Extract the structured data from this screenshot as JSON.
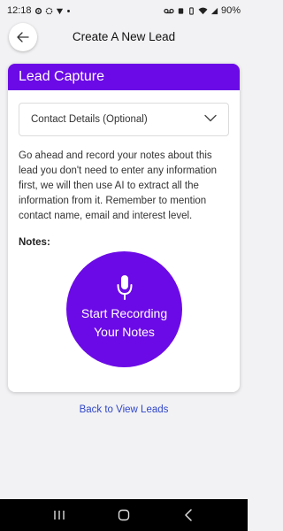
{
  "status_bar": {
    "time": "12:18",
    "battery": "90%",
    "left_icons": [
      "gear-icon",
      "settings-icon",
      "location-icon",
      "dot-icon"
    ],
    "right_icons": [
      "voicemail-icon",
      "alarm-icon",
      "vibrate-icon",
      "wifi-icon",
      "signal-icon"
    ]
  },
  "header": {
    "title": "Create A New Lead",
    "back_icon": "arrow-left-icon"
  },
  "card": {
    "title": "Lead Capture",
    "dropdown": {
      "label": "Contact Details (Optional)",
      "icon": "chevron-down-icon"
    },
    "instructions": "Go ahead and record your notes about this lead you don't need to enter any information first, we will then use AI to extract all the information from it. Remember to mention contact name, email and interest level.",
    "notes_label": "Notes:",
    "record_button": {
      "line1": "Start Recording",
      "line2": "Your Notes",
      "icon": "microphone-icon"
    }
  },
  "back_link": "Back to View Leads",
  "nav_bar": {
    "icons": [
      "recent-apps-icon",
      "home-icon",
      "back-icon"
    ]
  },
  "colors": {
    "accent": "#6b0ae6",
    "link": "#2f46c9",
    "background": "#f2f2f4"
  }
}
